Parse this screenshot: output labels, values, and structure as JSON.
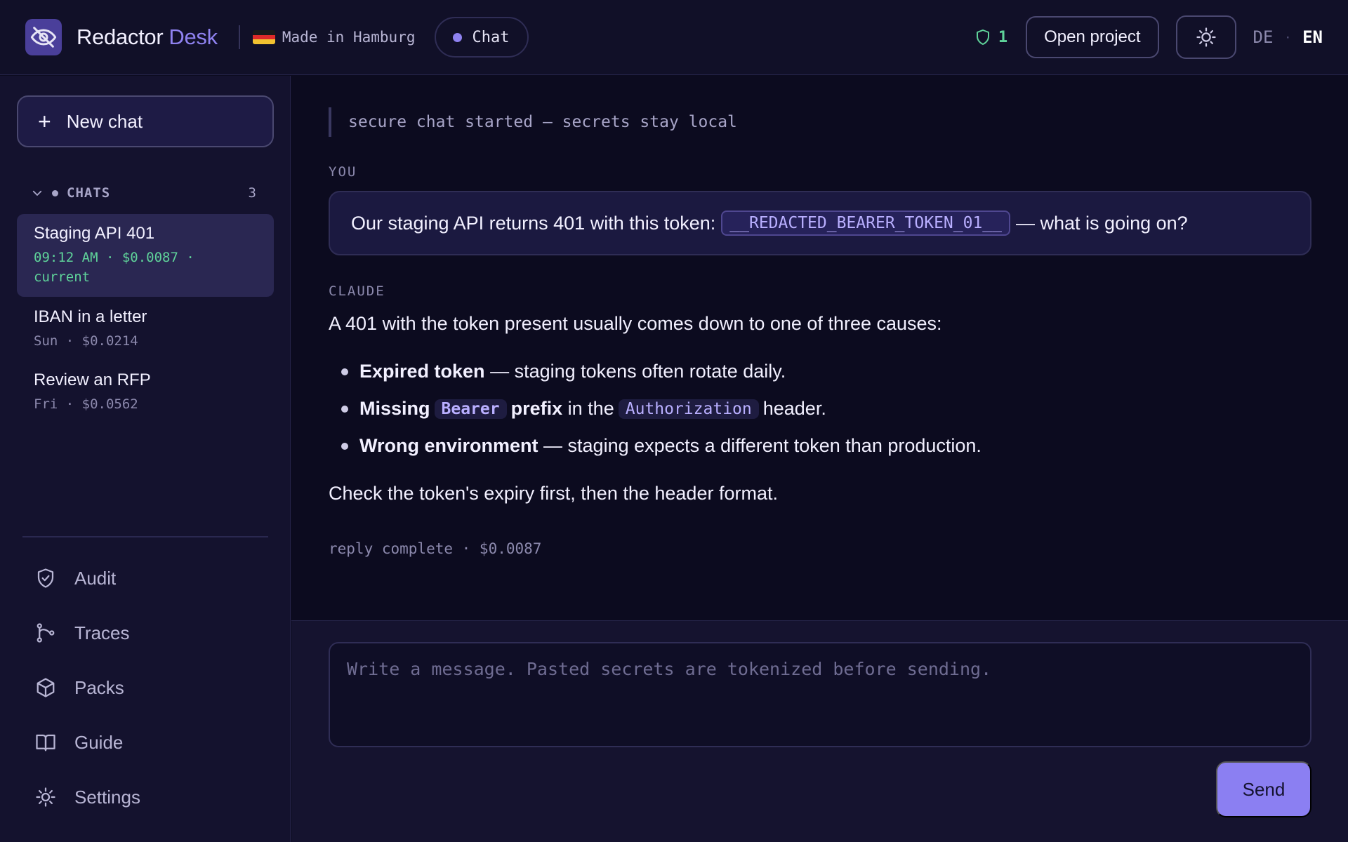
{
  "header": {
    "brand_main": "Redactor",
    "brand_accent": "Desk",
    "made_in": "Made in Hamburg",
    "mode_pill": "Chat",
    "shield_count": "1",
    "open_project_label": "Open project",
    "lang_de": "DE",
    "lang_sep": "·",
    "lang_en": "EN",
    "icons": [
      "eye-slash-icon",
      "germany-flag-icon",
      "shield-icon",
      "theme-sun-icon"
    ]
  },
  "sidebar": {
    "new_chat_label": "New chat",
    "section_label": "CHATS",
    "section_count": "3",
    "chats": [
      {
        "title": "Staging API 401",
        "meta": "09:12 AM · $0.0087 · current"
      },
      {
        "title": "IBAN in a letter",
        "meta": "Sun · $0.0214"
      },
      {
        "title": "Review an RFP",
        "meta": "Fri · $0.0562"
      }
    ],
    "nav": [
      {
        "label": "Audit",
        "icon": "shield-check-icon"
      },
      {
        "label": "Traces",
        "icon": "branch-icon"
      },
      {
        "label": "Packs",
        "icon": "box-icon"
      },
      {
        "label": "Guide",
        "icon": "book-icon"
      },
      {
        "label": "Settings",
        "icon": "gear-icon"
      }
    ]
  },
  "conversation": {
    "system_note": "secure chat started — secrets stay local",
    "user_role": "YOU",
    "user_message": {
      "before": "Our staging API returns 401 with this token:",
      "token": "__REDACTED_BEARER_TOKEN_01__",
      "after": "— what is going on?"
    },
    "assistant_role": "CLAUDE",
    "assistant": {
      "intro": "A 401 with the token present usually comes down to one of three causes:",
      "bullets": [
        {
          "strong": "Expired token",
          "rest": "— staging tokens often rotate daily."
        },
        {
          "strong": "Missing",
          "code": "Bearer",
          "strong2": "prefix",
          "mid": "in the",
          "code2": "Authorization",
          "rest": "header."
        },
        {
          "strong": "Wrong environment",
          "rest": "— staging expects a different token than production."
        }
      ],
      "closing": "Check the token's expiry first, then the header format."
    },
    "reply_meta": "reply complete · $0.0087"
  },
  "composer": {
    "placeholder": "Write a message. Pasted secrets are tokenized before sending.",
    "value": "",
    "send_label": "Send"
  },
  "colors": {
    "accent": "#8f82f0",
    "success": "#5fd39a",
    "background": "#0c0b1f",
    "sidebar": "#14122e"
  }
}
